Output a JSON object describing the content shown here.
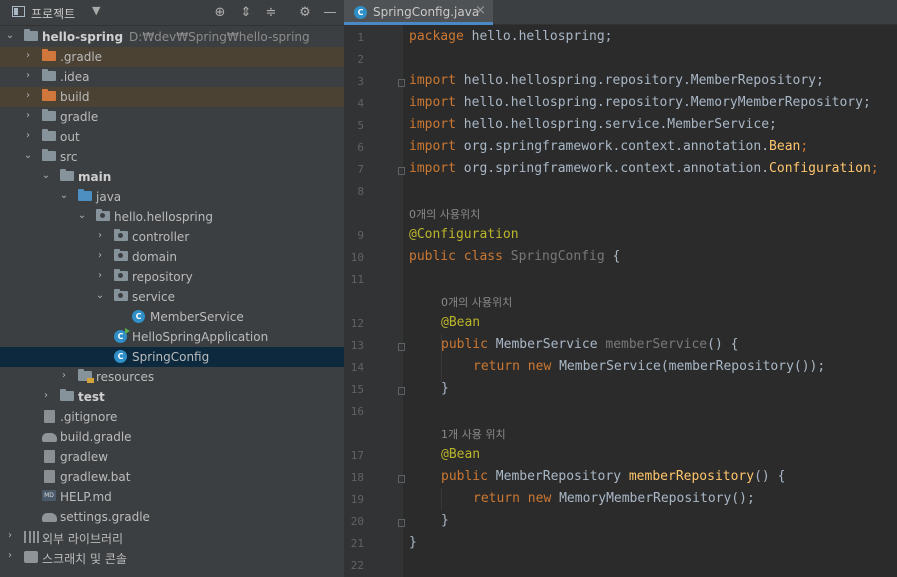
{
  "project_panel": {
    "title": "프로젝트",
    "root": {
      "name": "hello-spring",
      "path": "D:₩dev₩Spring₩hello-spring"
    },
    "tree": {
      "gradle_dot": ".gradle",
      "idea": ".idea",
      "build": "build",
      "gradle": "gradle",
      "out": "out",
      "src": "src",
      "main": "main",
      "java": "java",
      "package": "hello.hellospring",
      "controller": "controller",
      "domain": "domain",
      "repository": "repository",
      "service": "service",
      "member_service": "MemberService",
      "hello_app": "HelloSpringApplication",
      "spring_config": "SpringConfig",
      "resources": "resources",
      "test": "test",
      "gitignore": ".gitignore",
      "build_gradle": "build.gradle",
      "gradlew": "gradlew",
      "gradlew_bat": "gradlew.bat",
      "help_md": "HELP.md",
      "settings_gradle": "settings.gradle",
      "external_libs": "외부 라이브러리",
      "scratches": "스크래치 및 콘솔"
    },
    "colors": {
      "excluded_highlight": "#4b4233",
      "selected": "#0d293e",
      "class_icon": "#2f8fc6"
    }
  },
  "editor": {
    "tab_label": "SpringConfig.java",
    "line_numbers": [
      "1",
      "2",
      "3",
      "4",
      "5",
      "6",
      "7",
      "8",
      "9",
      "10",
      "11",
      "12",
      "13",
      "14",
      "15",
      "16",
      "17",
      "18",
      "19",
      "20",
      "21",
      "22"
    ],
    "code": {
      "l1_kw": "package",
      "l1_rest": " hello.hellospring;",
      "import_kw": "import",
      "l3": " hello.hellospring.repository.MemberRepository;",
      "l4": " hello.hellospring.repository.MemoryMemberRepository;",
      "l5": " hello.hellospring.service.MemberService;",
      "l6_a": " org.springframework.context.annotation.",
      "l6_b": "Bean",
      "l6_c": ";",
      "l7_a": " org.springframework.context.annotation.",
      "l7_b": "Configuration",
      "l7_c": ";",
      "hint1": "0개의 사용위치",
      "l9": "@Configuration",
      "l10_kw": "public class",
      "l10_name": " SpringConfig",
      "l10_rest": " {",
      "hint2": "0개의 사용위치",
      "l12": "@Bean",
      "l13_kw": "public",
      "l13_type": " MemberService",
      "l13_name": " memberService",
      "l13_rest": "() {",
      "l14_kw": "return new",
      "l14_rest": " MemberService(memberRepository());",
      "l15": "}",
      "hint3": "1개 사용 위치",
      "l17": "@Bean",
      "l18_kw": "public",
      "l18_type": " MemberRepository",
      "l18_name": " memberRepository",
      "l18_rest": "() {",
      "l19_kw": "return new",
      "l19_rest": " MemoryMemberRepository();",
      "l20": "}",
      "l21": "}"
    },
    "colors": {
      "keyword": "#cc7832",
      "annotation": "#bbb529",
      "method_decl": "#ffc66d",
      "text": "#a9b7c6",
      "unused": "#787878"
    }
  }
}
